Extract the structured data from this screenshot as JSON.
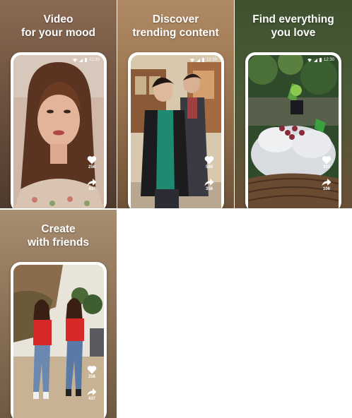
{
  "cards": [
    {
      "caption_line1": "Video",
      "caption_line2": "for your mood",
      "status_time": "12:30",
      "like_count": "256",
      "share_count": "437"
    },
    {
      "caption_line1": "Discover",
      "caption_line2": "trending content",
      "status_time": "12:30",
      "like_count": "584",
      "share_count": "356"
    },
    {
      "caption_line1": "Find everything",
      "caption_line2": "you love",
      "status_time": "12:30",
      "like_count": "331",
      "share_count": "106"
    },
    {
      "caption_line1": "Create",
      "caption_line2": "with friends",
      "status_time": "",
      "like_count": "256",
      "share_count": "437"
    }
  ],
  "icons": {
    "like": "heart-icon",
    "share": "share-arrow-icon",
    "wifi": "wifi-icon",
    "signal": "signal-icon",
    "battery": "battery-icon"
  }
}
